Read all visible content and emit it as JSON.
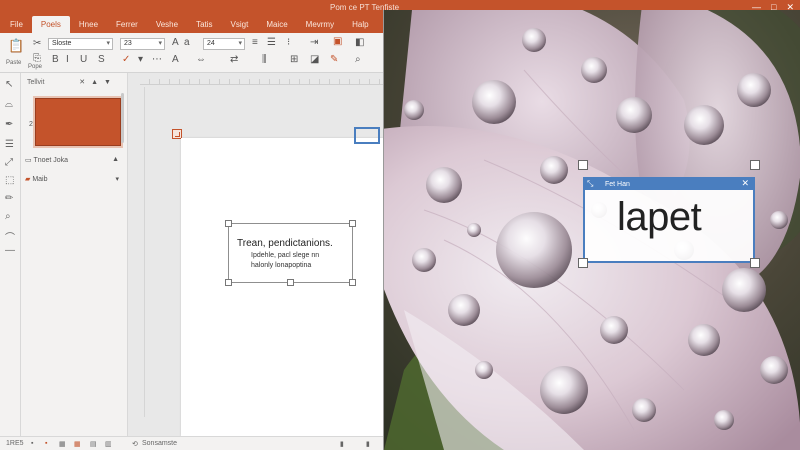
{
  "window": {
    "title": "Pom ce PT Tenfiste",
    "controls": [
      "—",
      "□",
      "✕"
    ]
  },
  "tabs": [
    "File",
    "Poels",
    "Hnee",
    "Ferrer",
    "Veshe",
    "Tatis",
    "Vsigt",
    "Maice",
    "Mevrmy",
    "Halp"
  ],
  "ribbon": {
    "paste_label": "Paste",
    "clipboard_label": "Pope",
    "font_name": "Sloste",
    "font_size": "23",
    "font_size_2": "24"
  },
  "slide_panel": {
    "header": "Tellvit",
    "thumb_number": "2",
    "section1": "Tnoet Joka",
    "section2": "Maib"
  },
  "slide": {
    "line1": "Trean, pendictanions.",
    "line2": "Ipdehle, pacl slege nn",
    "line3": "halonly lonapoptina"
  },
  "overlay": {
    "title": "Fet Han",
    "text": "lapet"
  },
  "status": {
    "slide_info": "1RE5",
    "view_label": "Sonsamste"
  },
  "colors": {
    "accent": "#c4532b",
    "selection": "#4a7ebf"
  }
}
